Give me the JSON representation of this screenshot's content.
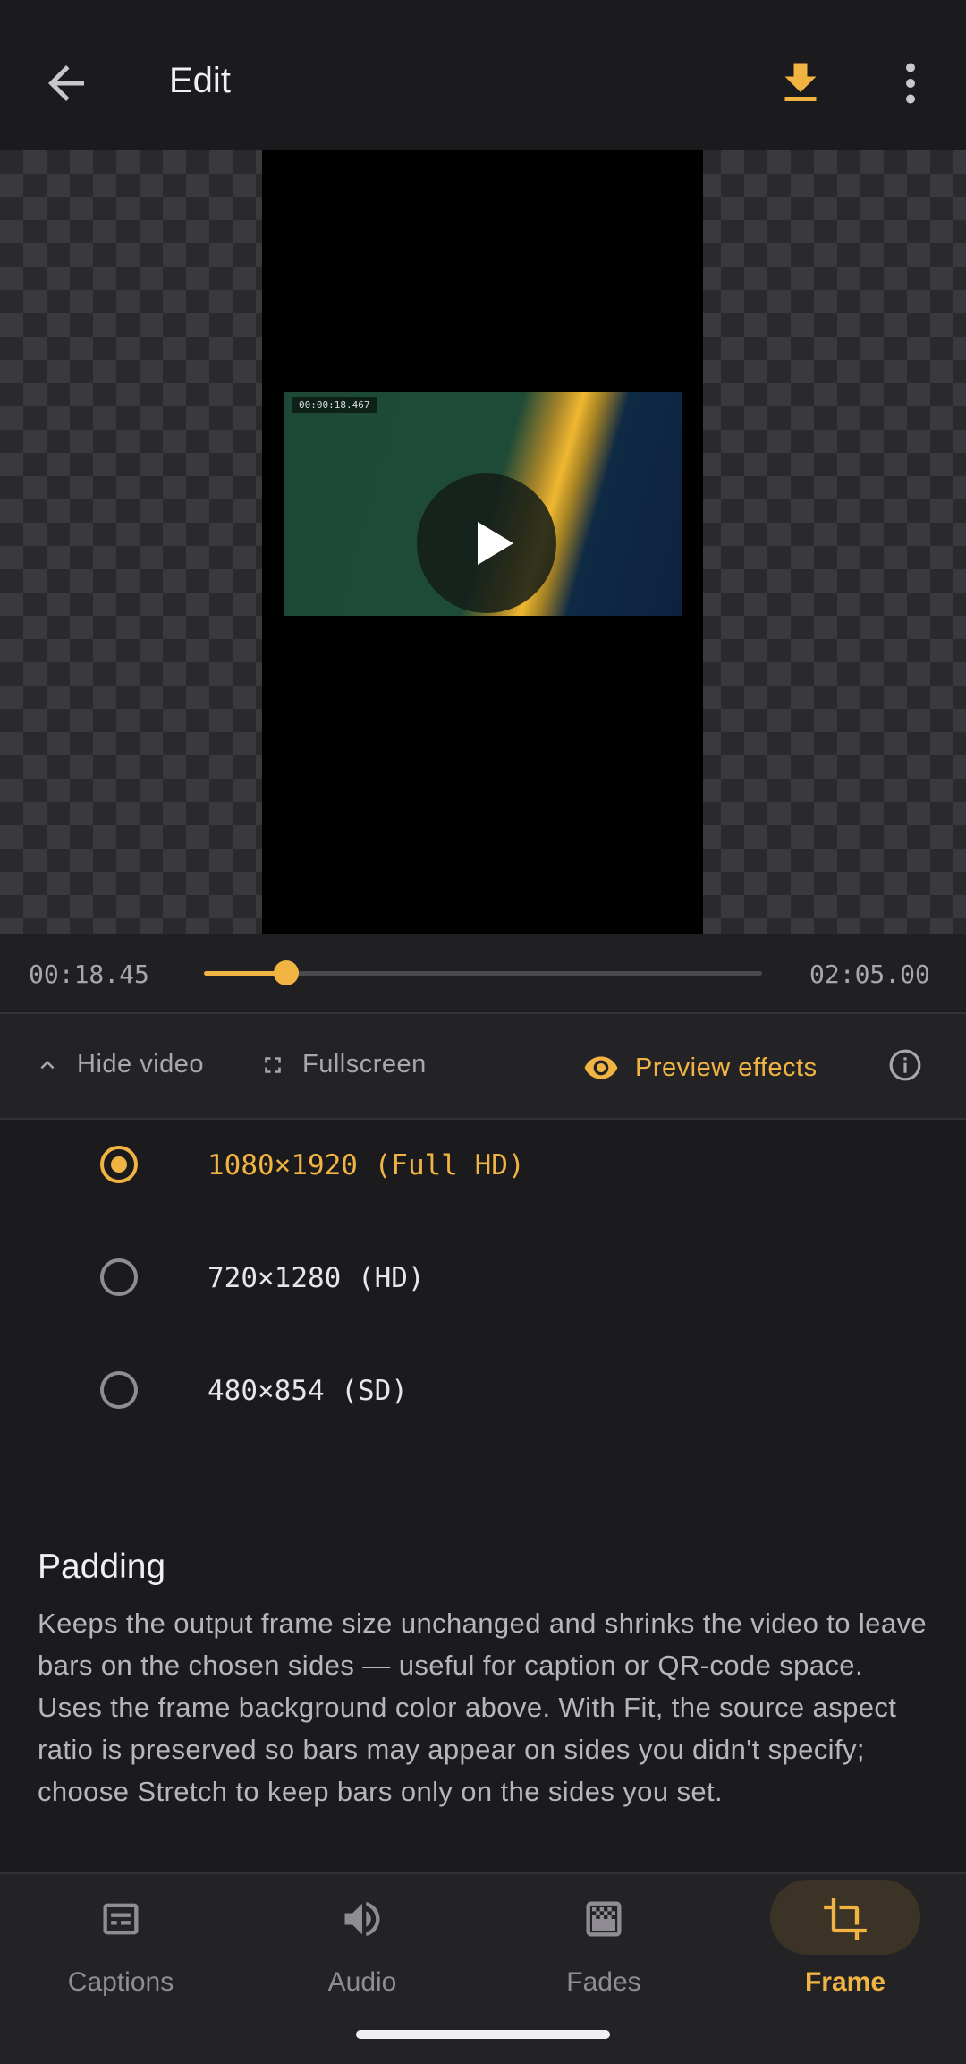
{
  "topbar": {
    "title": "Edit",
    "back_icon": "arrow-left-icon",
    "download_icon": "download-icon",
    "more_icon": "more-vert-icon"
  },
  "player": {
    "overlay_timestamp": "00:00:18.467",
    "current_time": "00:18.45",
    "duration": "02:05.00",
    "progress": 0.147
  },
  "controls": {
    "hide_video": "Hide video",
    "fullscreen": "Fullscreen",
    "preview_effects": "Preview effects"
  },
  "resolution_options": [
    {
      "label": "1080×1920 (Full HD)",
      "selected": true
    },
    {
      "label": "720×1280 (HD)",
      "selected": false
    },
    {
      "label": "480×854 (SD)",
      "selected": false
    }
  ],
  "padding": {
    "title": "Padding",
    "description": "Keeps the output frame size unchanged and shrinks the video to leave bars on the chosen sides — useful for caption or QR-code space. Uses the frame background color above. With Fit, the source aspect ratio is preserved so bars may appear on sides you didn't specify; choose Stretch to keep bars only on the sides you set."
  },
  "nav": [
    {
      "label": "Captions",
      "icon": "captions-icon",
      "active": false
    },
    {
      "label": "Audio",
      "icon": "volume-icon",
      "active": false
    },
    {
      "label": "Fades",
      "icon": "fades-icon",
      "active": false
    },
    {
      "label": "Frame",
      "icon": "crop-icon",
      "active": true
    }
  ],
  "colors": {
    "accent": "#f1b443",
    "background": "#1b1b1d",
    "surface": "#232326"
  }
}
